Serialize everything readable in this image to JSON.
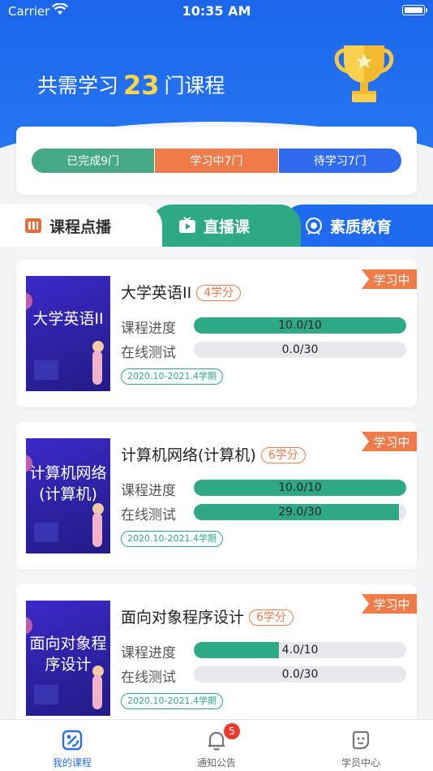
{
  "status_bar": {
    "carrier": "Carrier",
    "time": "10:35 AM"
  },
  "header": {
    "prefix": "共需学习",
    "count": "23",
    "suffix": "门课程"
  },
  "summary": {
    "completed": "已完成9门",
    "learning": "学习中7门",
    "pending": "待学习7门"
  },
  "tabs": {
    "courses": "课程点播",
    "live": "直播课",
    "quality": "素质教育"
  },
  "courses": [
    {
      "cover_text": "大学英语II",
      "name": "大学英语II",
      "credit": "4学分",
      "status": "学习中",
      "progress_label": "课程进度",
      "progress_text": "10.0/10",
      "progress_fraction": 1.0,
      "test_label": "在线测试",
      "test_text": "0.0/30",
      "test_fraction": 0.0,
      "term": "2020.10-2021.4学期"
    },
    {
      "cover_text": "计算机网络(计算机)",
      "name": "计算机网络(计算机)",
      "credit": "6学分",
      "status": "学习中",
      "progress_label": "课程进度",
      "progress_text": "10.0/10",
      "progress_fraction": 1.0,
      "test_label": "在线测试",
      "test_text": "29.0/30",
      "test_fraction": 0.967,
      "term": "2020.10-2021.4学期"
    },
    {
      "cover_text": "面向对象程序设计",
      "name": "面向对象程序设计",
      "credit": "6学分",
      "status": "学习中",
      "progress_label": "课程进度",
      "progress_text": "4.0/10",
      "progress_fraction": 0.4,
      "test_label": "在线测试",
      "test_text": "0.0/30",
      "test_fraction": 0.0,
      "term": "2020.10-2021.4学期"
    }
  ],
  "tabbar": {
    "my_courses": "我的课程",
    "notices": "通知公告",
    "notices_badge": "5",
    "student_center": "学员中心"
  },
  "colors": {
    "primary": "#1f6bf0",
    "green": "#2daa85",
    "orange": "#ef7b4b",
    "gold": "#ffd54a"
  }
}
